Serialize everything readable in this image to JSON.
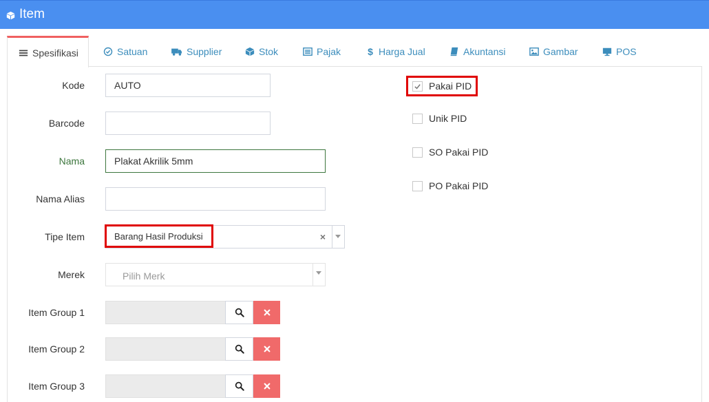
{
  "window": {
    "title": "Item",
    "icon": "cube-icon"
  },
  "tabs": [
    {
      "label": "Spesifikasi",
      "icon": "list-icon",
      "active": true
    },
    {
      "label": "Satuan",
      "icon": "check-circle-icon"
    },
    {
      "label": "Supplier",
      "icon": "truck-icon"
    },
    {
      "label": "Stok",
      "icon": "cube-icon"
    },
    {
      "label": "Pajak",
      "icon": "list-alt-icon"
    },
    {
      "label": "Harga Jual",
      "icon": "dollar-icon"
    },
    {
      "label": "Akuntansi",
      "icon": "book-icon"
    },
    {
      "label": "Gambar",
      "icon": "image-icon"
    },
    {
      "label": "POS",
      "icon": "monitor-icon"
    }
  ],
  "form": {
    "kode": {
      "label": "Kode",
      "value": "AUTO"
    },
    "barcode": {
      "label": "Barcode",
      "value": ""
    },
    "nama": {
      "label": "Nama",
      "value": "Plakat Akrilik 5mm"
    },
    "nama_alias": {
      "label": "Nama Alias",
      "value": ""
    },
    "tipe_item": {
      "label": "Tipe Item",
      "value": "Barang Hasil Produksi",
      "clear": "×"
    },
    "merek": {
      "label": "Merek",
      "placeholder": "Pilih Merk"
    },
    "item_group_1": {
      "label": "Item Group 1",
      "value": ""
    },
    "item_group_2": {
      "label": "Item Group 2",
      "value": ""
    },
    "item_group_3": {
      "label": "Item Group 3",
      "value": ""
    }
  },
  "checkboxes": [
    {
      "label": "Pakai PID",
      "checked": true
    },
    {
      "label": "Unik PID",
      "checked": false
    },
    {
      "label": "SO Pakai PID",
      "checked": false
    },
    {
      "label": "PO Pakai PID",
      "checked": false
    }
  ],
  "colors": {
    "header": "#4a8ff0",
    "link": "#3c8dbc",
    "delete": "#f06a6a",
    "highlight": "#e00000",
    "valid": "#3c763d"
  }
}
